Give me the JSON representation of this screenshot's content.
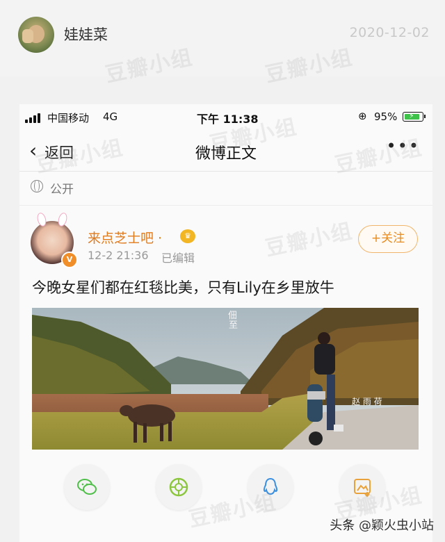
{
  "repost": {
    "username": "娃娃菜",
    "date": "2020-12-02"
  },
  "status_bar": {
    "carrier": "中国移动",
    "network": "4G",
    "time": "下午 11:38",
    "battery": "95%",
    "battery_level": 0.95
  },
  "nav": {
    "back_label": "返回",
    "title": "微博正文",
    "more": "•••"
  },
  "visibility": "公开",
  "post": {
    "author": "来点芝士吧 ·",
    "time": "12-2 21:36",
    "edited": "已编辑",
    "follow_label": "+关注",
    "text": "今晚女星们都在红毯比美，只有Lily在乡里放牛",
    "image_captions": [
      "佃",
      "至",
      "赵 雨 荷"
    ]
  },
  "share": {
    "icons": [
      "wechat-icon",
      "moments-icon",
      "qq-icon",
      "save-image-icon"
    ]
  },
  "watermark": "豆瓣小组",
  "credit": {
    "source": "头条",
    "handle": "@颖火虫小站"
  },
  "colors": {
    "accent_orange": "#e88b20",
    "wechat_green": "#4fbf4a",
    "qq_blue": "#3a8fe0",
    "gallery_orange": "#e9a23b"
  }
}
